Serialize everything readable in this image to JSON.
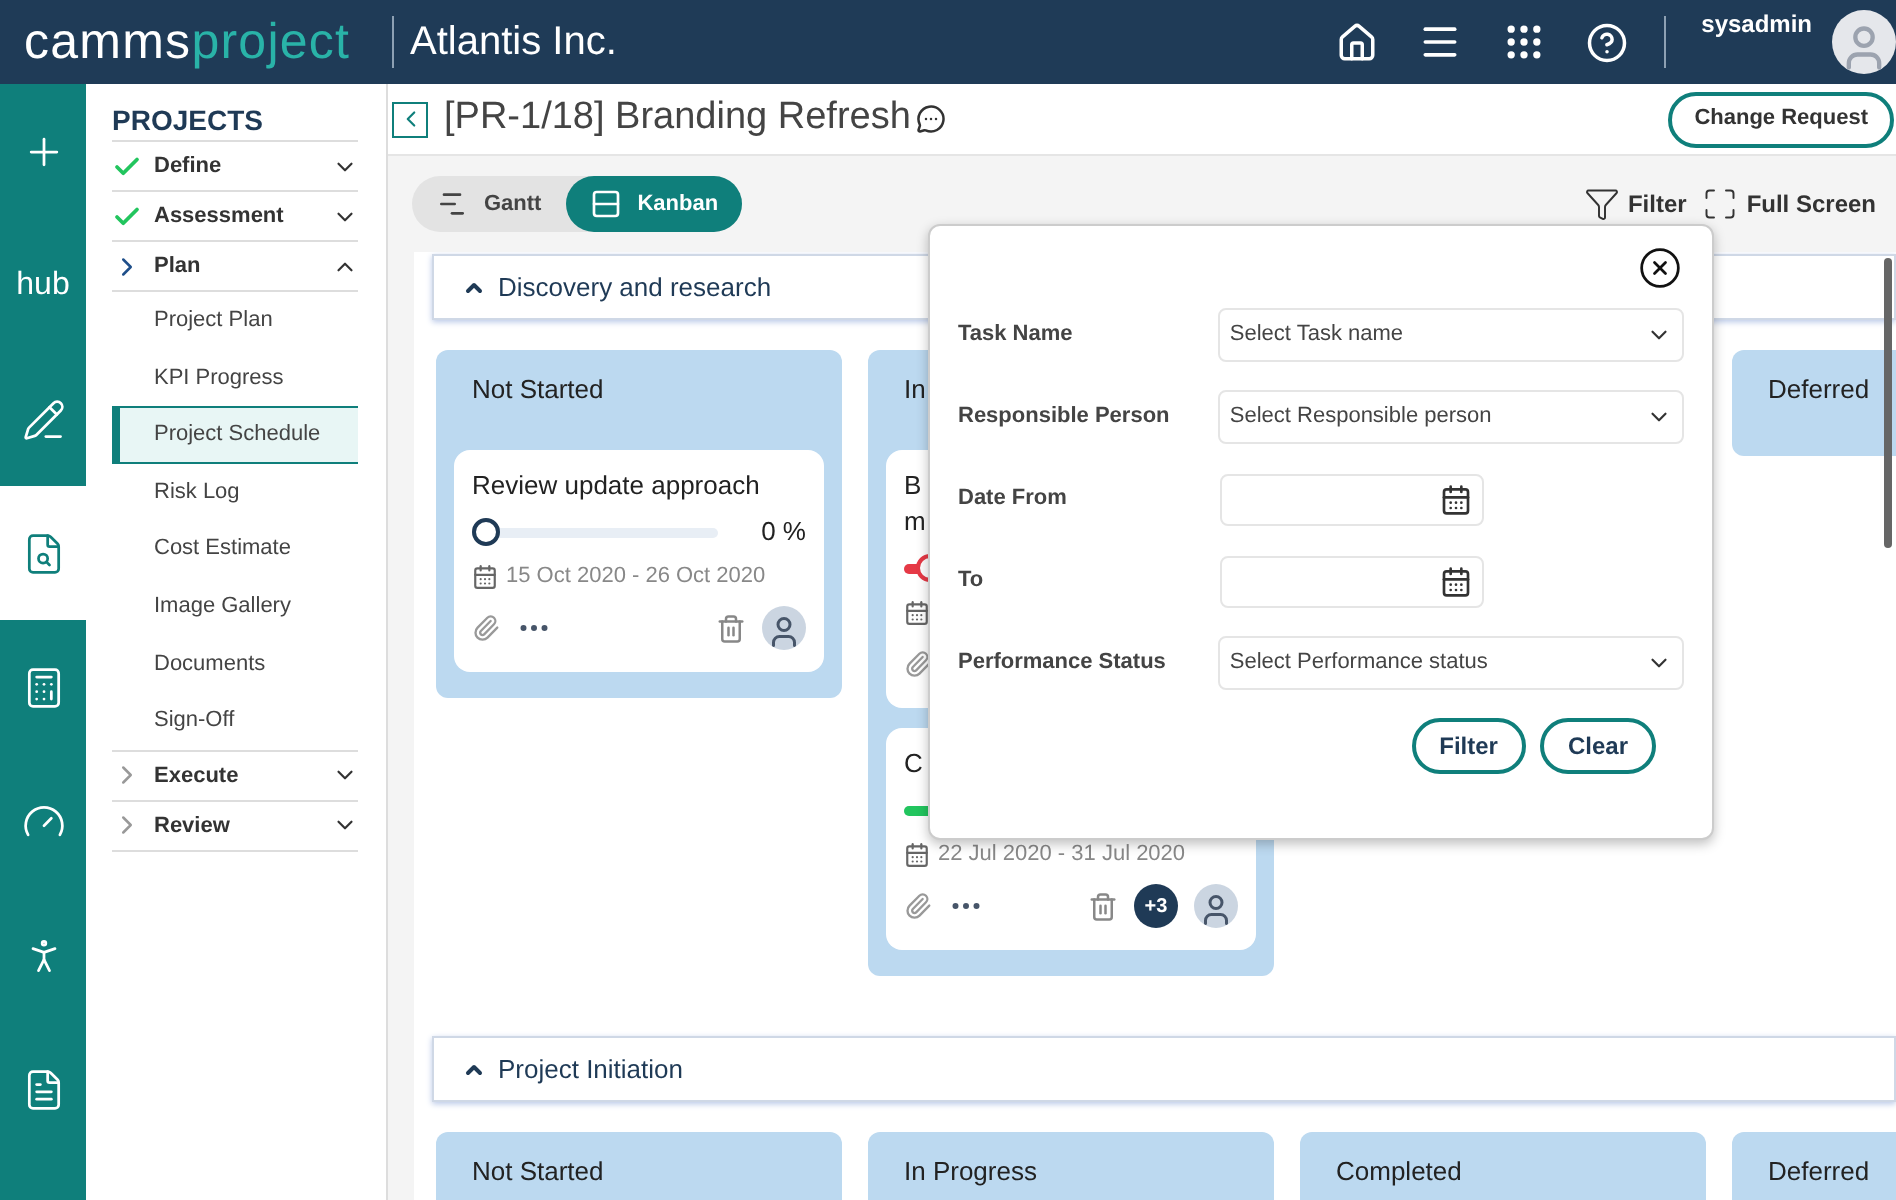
{
  "header": {
    "logo": [
      "camms",
      "project"
    ],
    "company": "Atlantis Inc.",
    "user": "sysadmin"
  },
  "rail": [
    {
      "selected": false
    },
    {
      "text": "hub",
      "selected": false
    },
    {
      "selected": false
    },
    {
      "selected": true
    },
    {
      "selected": false
    },
    {
      "selected": false
    },
    {
      "selected": false
    },
    {
      "selected": false
    }
  ],
  "sidebar": {
    "title": "PROJECTS",
    "groups": [
      {
        "label": "Define",
        "done": true,
        "expanded": false
      },
      {
        "label": "Assessment",
        "done": true,
        "expanded": false
      },
      {
        "label": "Plan",
        "done": false,
        "expanded": true,
        "children": [
          {
            "label": "Project Plan",
            "selected": false
          },
          {
            "label": "KPI Progress",
            "selected": false
          },
          {
            "label": "Project Schedule",
            "selected": true
          },
          {
            "label": "Risk Log",
            "selected": false
          },
          {
            "label": "Cost Estimate",
            "selected": false
          },
          {
            "label": "Image Gallery",
            "selected": false
          },
          {
            "label": "Documents",
            "selected": false
          },
          {
            "label": "Sign-Off",
            "selected": false
          }
        ]
      },
      {
        "label": "Execute",
        "done": false,
        "expanded": false
      },
      {
        "label": "Review",
        "done": false,
        "expanded": false
      }
    ]
  },
  "page": {
    "title": "[PR-1/18] Branding Refresh",
    "action": "Change Request"
  },
  "views": [
    {
      "label": "Gantt",
      "selected": false
    },
    {
      "label": "Kanban",
      "selected": true
    }
  ],
  "tools": [
    {
      "kind": "filter",
      "label": "Filter"
    },
    {
      "kind": "fullscreen",
      "label": "Full Screen"
    }
  ],
  "sections": [
    {
      "title": "Discovery and research",
      "expanded": true,
      "columns": [
        {
          "title": "Not Started",
          "cards": [
            {
              "title_lines": [
                "Review update approach"
              ],
              "color": "#1f3a56",
              "level": 0,
              "thumb": true,
              "reading": "0 %",
              "dates": "15 Oct 2020 - 26 Oct 2020"
            }
          ]
        },
        {
          "title": "In",
          "cards": [
            {
              "title_lines": [
                "B",
                "m"
              ],
              "color": "#e63946",
              "level": 0.08,
              "thumb": true
            },
            {
              "title_lines": [
                "C"
              ],
              "color": "#22c55e",
              "level": 0.6,
              "dates": "22 Jul 2020 - 31 Jul 2020",
              "extra": "+3"
            }
          ]
        },
        {},
        {
          "title": "Deferred"
        }
      ]
    },
    {
      "title": "Project Initiation",
      "expanded": true,
      "columns": [
        {
          "title": "Not Started"
        },
        {
          "title": "In Progress"
        },
        {
          "title": "Completed"
        },
        {
          "title": "Deferred"
        }
      ]
    }
  ],
  "filter_panel": {
    "fields": [
      {
        "kind": "select",
        "label": "Task Name",
        "placeholder": "Select Task name"
      },
      {
        "kind": "select",
        "label": "Responsible Person",
        "placeholder": "Select Responsible person"
      },
      {
        "kind": "date",
        "label": "Date From"
      },
      {
        "kind": "date",
        "label": "To"
      },
      {
        "kind": "select",
        "label": "Performance Status",
        "placeholder": "Select Performance status"
      }
    ],
    "buttons": [
      "Filter",
      "Clear"
    ]
  }
}
